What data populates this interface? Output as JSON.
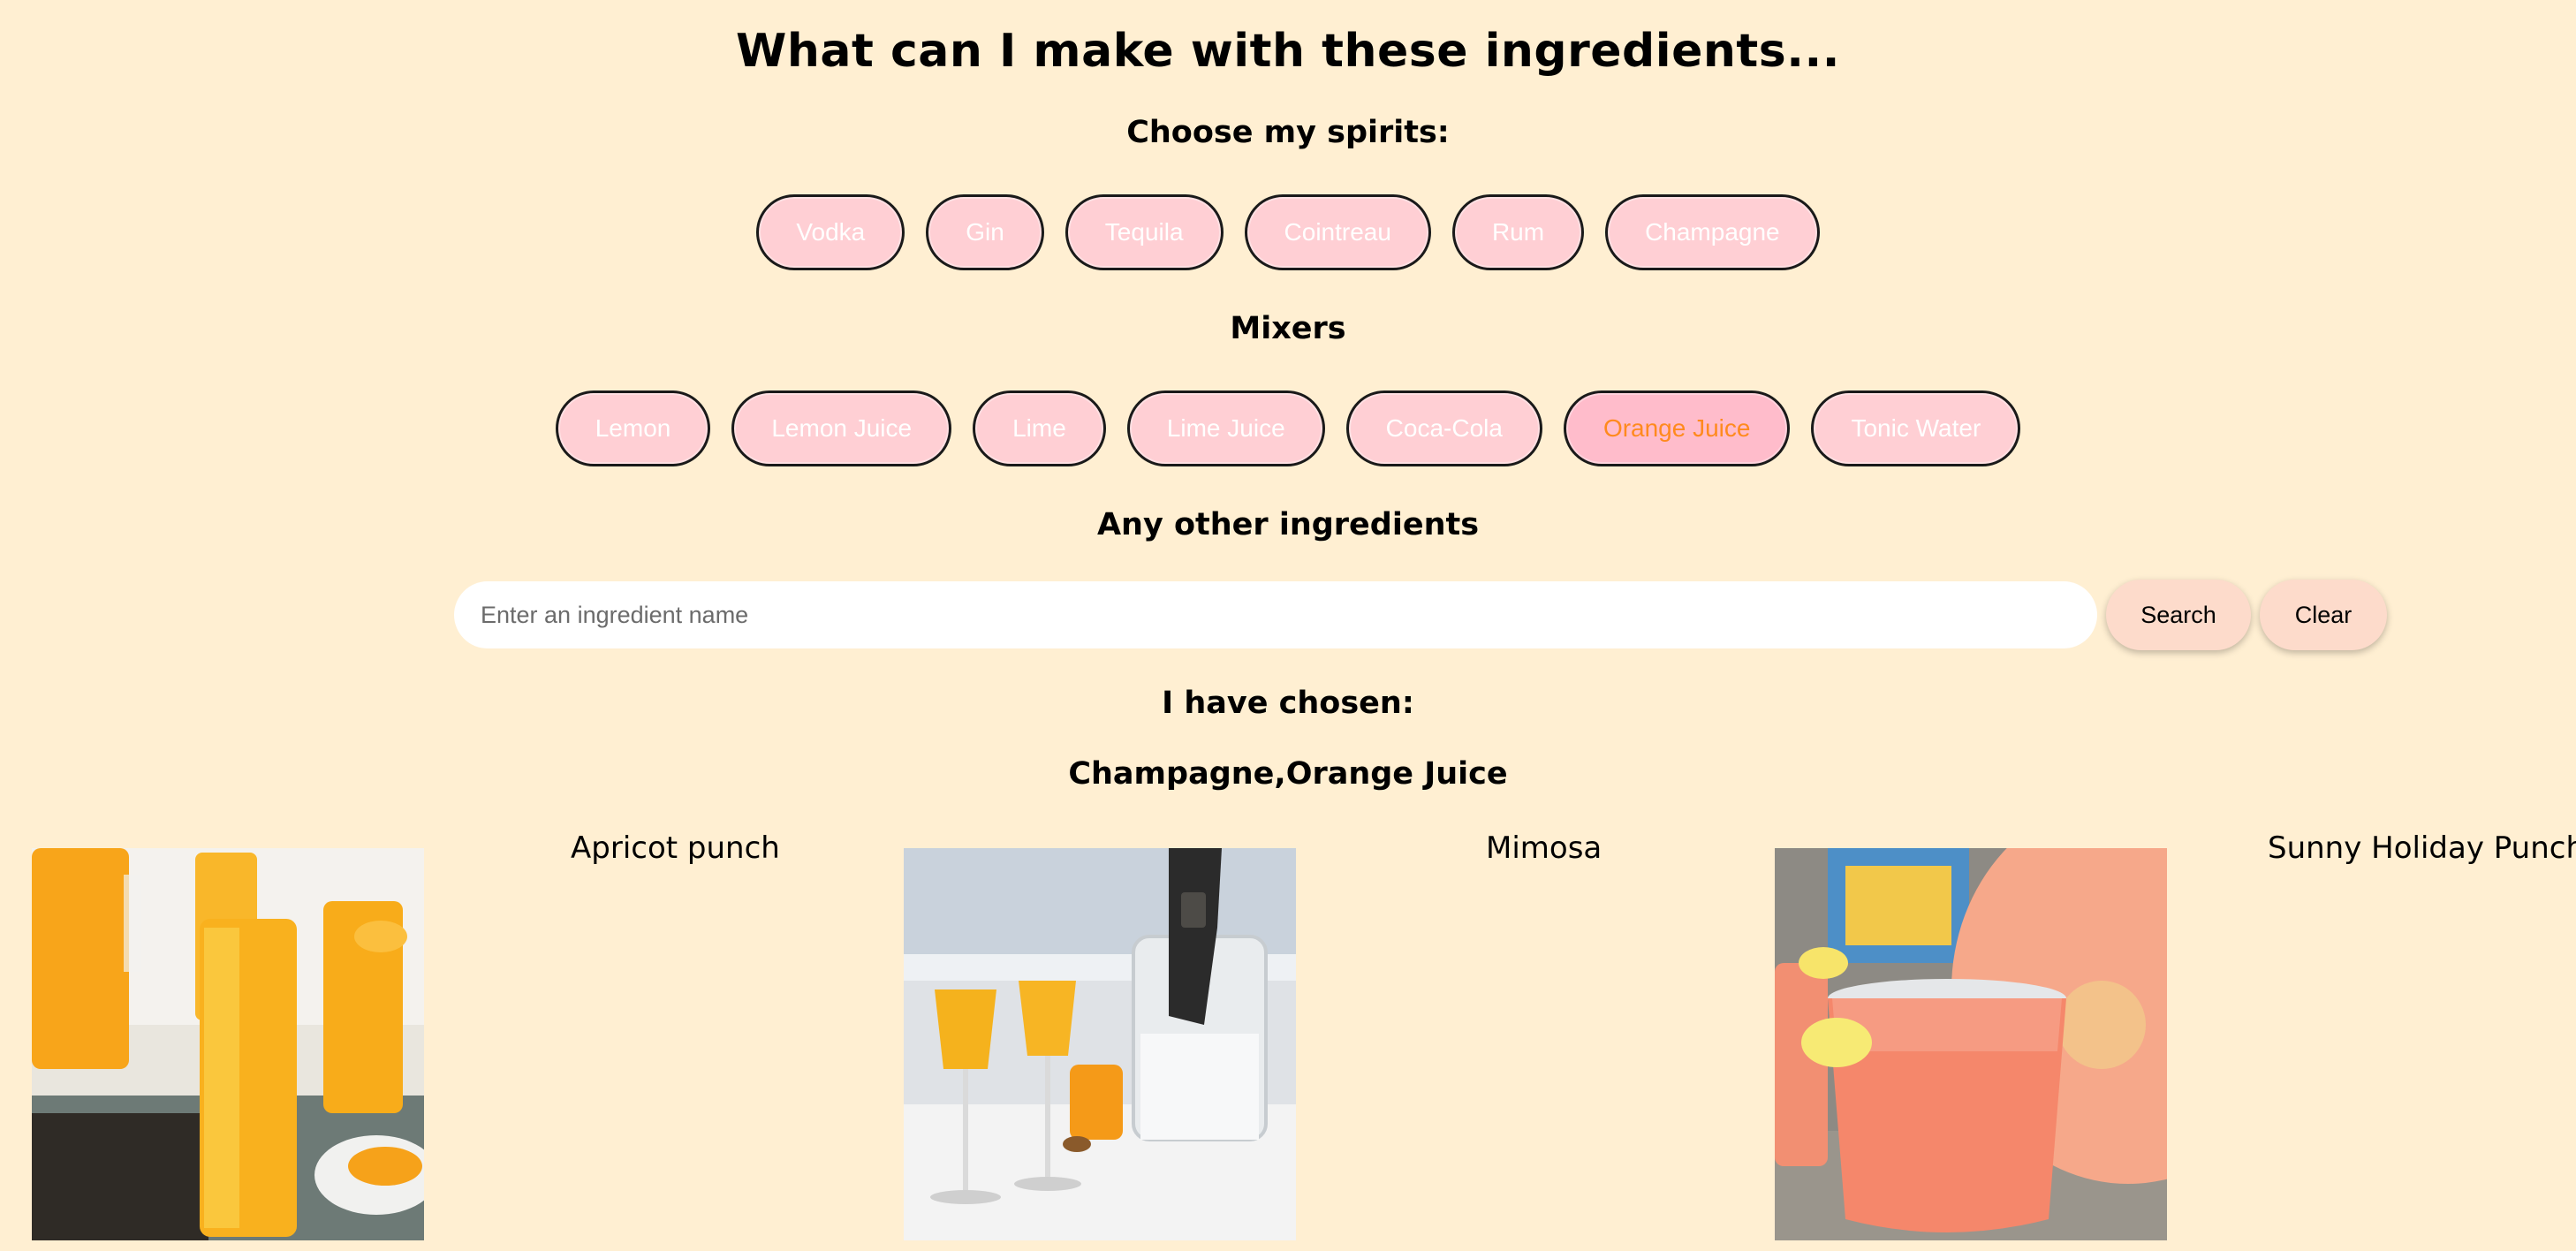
{
  "title": "What can I make with these ingredients...",
  "spirits": {
    "heading": "Choose my spirits:",
    "items": [
      {
        "label": "Vodka",
        "active": false
      },
      {
        "label": "Gin",
        "active": false
      },
      {
        "label": "Tequila",
        "active": false
      },
      {
        "label": "Cointreau",
        "active": false
      },
      {
        "label": "Rum",
        "active": false
      },
      {
        "label": "Champagne",
        "active": false
      }
    ]
  },
  "mixers": {
    "heading": "Mixers",
    "items": [
      {
        "label": "Lemon",
        "active": false
      },
      {
        "label": "Lemon Juice",
        "active": false
      },
      {
        "label": "Lime",
        "active": false
      },
      {
        "label": "Lime Juice",
        "active": false
      },
      {
        "label": "Coca-Cola",
        "active": false
      },
      {
        "label": "Orange Juice",
        "active": true
      },
      {
        "label": "Tonic Water",
        "active": false
      }
    ]
  },
  "other": {
    "heading": "Any other ingredients",
    "input_value": "",
    "placeholder": "Enter an ingredient name",
    "search_label": "Search",
    "clear_label": "Clear"
  },
  "chosen": {
    "heading": "I have chosen:",
    "value": "Champagne,Orange Juice"
  },
  "results": [
    {
      "name": "Apricot punch"
    },
    {
      "name": "Mimosa"
    },
    {
      "name": "Sunny Holiday Punch"
    }
  ],
  "colors": {
    "background": "#ffefd2",
    "pill": "#ffcfd4",
    "pill_active": "#ffbccb",
    "pill_active_text": "#ff8a1e",
    "action_button": "#fddbcb"
  }
}
